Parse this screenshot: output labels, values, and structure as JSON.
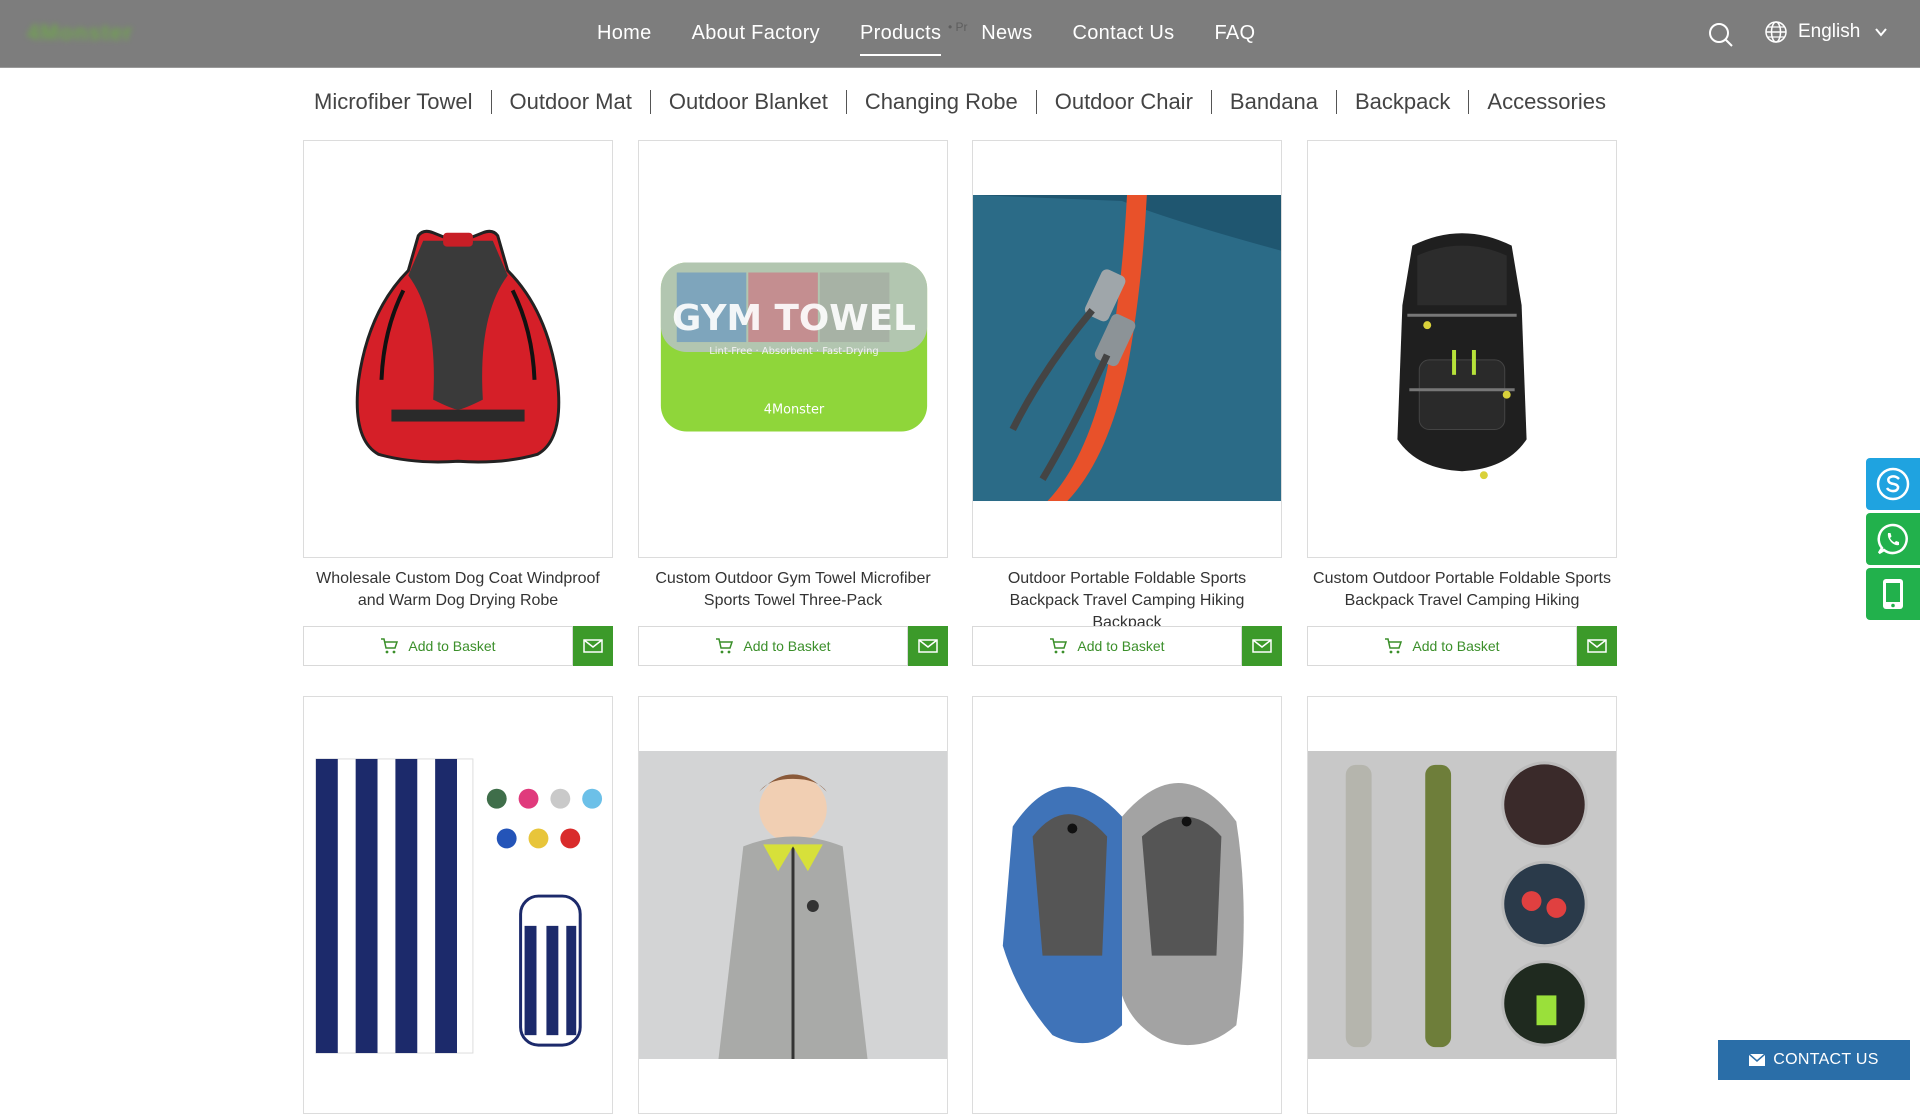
{
  "header": {
    "logo_text": "4Monster",
    "nav": [
      "Home",
      "About Factory",
      "Products",
      "News",
      "Contact Us",
      "FAQ"
    ],
    "active_nav": "Products",
    "breadcrumb_ghost": "• Pr",
    "language": "English"
  },
  "subnav": [
    "Microfiber Towel",
    "Outdoor Mat",
    "Outdoor Blanket",
    "Changing Robe",
    "Outdoor Chair",
    "Bandana",
    "Backpack",
    "Accessories"
  ],
  "products": [
    {
      "title": "Wholesale Custom Dog Coat Windproof and Warm Dog Drying Robe",
      "image": "dog-coat"
    },
    {
      "title": "Custom Outdoor Gym Towel Microfiber Sports Towel Three-Pack",
      "image": "gym-towel"
    },
    {
      "title": "Outdoor Portable Foldable Sports Backpack Travel Camping Hiking Backpack",
      "image": "backpack-zipper"
    },
    {
      "title": "Custom Outdoor Portable Foldable Sports Backpack Travel Camping Hiking",
      "image": "black-backpack"
    },
    {
      "title": "",
      "image": "striped-towel"
    },
    {
      "title": "",
      "image": "kid-changing-robe"
    },
    {
      "title": "",
      "image": "hooded-towels"
    },
    {
      "title": "",
      "image": "inflatable-tubes"
    }
  ],
  "gym_towel_text": {
    "main": "GYM TOWEL",
    "sub": "Lint-Free · Absorbent · Fast-Drying",
    "brand": "4Monster"
  },
  "basket_label": "Add to Basket",
  "contact_bar": "CONTACT US",
  "colors": {
    "header": "#7d7d7d",
    "accent_green": "#3c9a2a",
    "skype": "#1fa3e0",
    "whatsapp": "#22b14c",
    "contact_bar": "#2a6ea8"
  }
}
